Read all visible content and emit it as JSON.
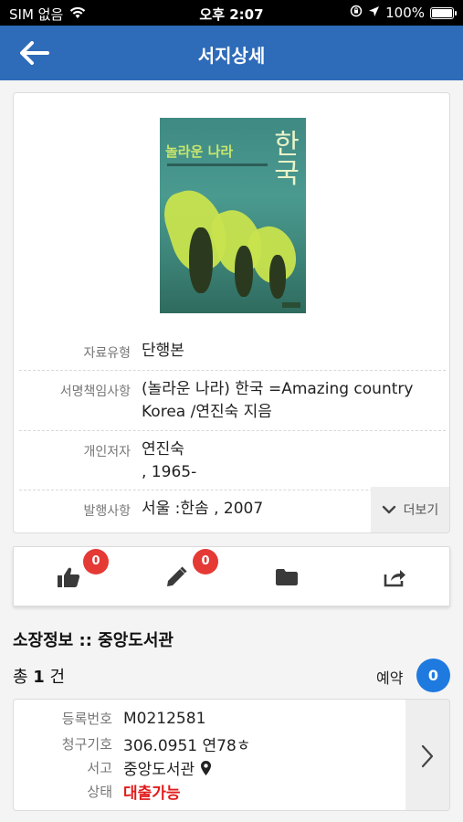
{
  "status_bar": {
    "carrier": "SIM 없음",
    "time": "오후 2:07",
    "battery_text": "100%",
    "battery_level": 1.0
  },
  "header": {
    "title": "서지상세",
    "back_icon": "arrow-left-icon"
  },
  "book": {
    "cover_title": "놀라운 나라",
    "cover_big": "한국",
    "fields": [
      {
        "label": "자료유형",
        "value": "단행본"
      },
      {
        "label": "서명책임사항",
        "value_lines": [
          "(놀라운 나라) 한국  =Amazing country",
          "Korea  /연진숙 지음"
        ]
      },
      {
        "label": "개인저자",
        "value_lines": [
          "연진숙",
          ", 1965-"
        ]
      },
      {
        "label": "발행사항",
        "value": "서울  :한솜 , 2007"
      }
    ],
    "more_label": "더보기"
  },
  "actions": {
    "like_count": "0",
    "review_count": "0",
    "icons": [
      "thumbs-up-icon",
      "pencil-icon",
      "folder-icon",
      "share-icon"
    ]
  },
  "holdings": {
    "title": "소장정보 :: 중앙도서관",
    "total_prefix": "총 ",
    "total_count": "1",
    "total_suffix": " 건",
    "reserve_label": "예약",
    "reserve_count": "0",
    "item": {
      "reg_label": "등록번호",
      "reg_value": "M0212581",
      "call_label": "청구기호",
      "call_value": "306.0951 연78ㅎ",
      "location_label": "서고",
      "location_value": "중앙도서관",
      "status_label": "상태",
      "status_value": "대출가능"
    }
  },
  "colors": {
    "header_bg": "#2e6bb8",
    "badge_red": "#e53935",
    "reserve_blue": "#1f7ae0",
    "status_red": "#e01b1b"
  }
}
